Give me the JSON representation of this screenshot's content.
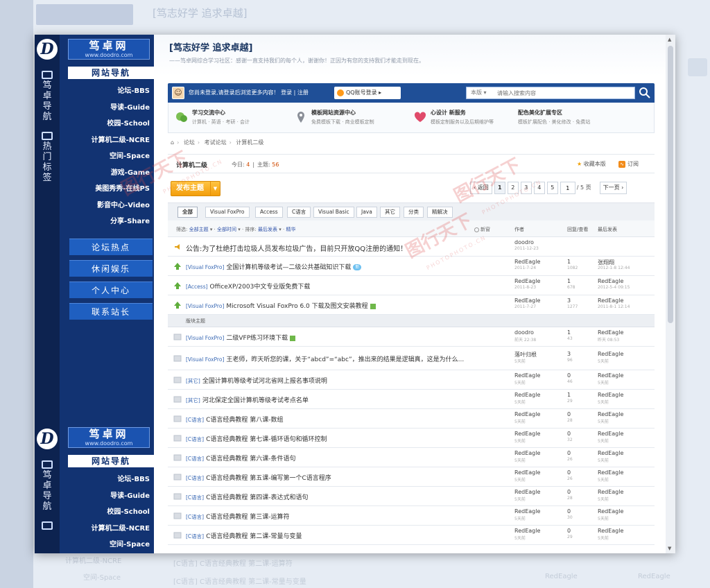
{
  "bg": {
    "title": "[笃志好学 追求卓越]",
    "nav_item_1": "计算机二级-NCRE",
    "nav_item_2": "空间-Space",
    "row_text_1": "[C语言] C语言经典教程 第二课-运算符",
    "row_text_2": "[C语言] C语言经典教程 第二课-常量与变量",
    "row_user": "RedEagle"
  },
  "rail": {
    "logo_letter": "D",
    "section1_label": "笃卓导航",
    "section2_label": "热门标签",
    "section3_label": "笃卓导航"
  },
  "nav": {
    "brand": "笃卓网",
    "brand_url": "www.doodro.com",
    "heading": "网站导航",
    "links": [
      "论坛-BBS",
      "导读-Guide",
      "校园-School",
      "计算机二级-NCRE",
      "空间-Space",
      "游戏-Game",
      "美图秀秀-在线PS",
      "影音中心-Video",
      "分享-Share"
    ],
    "buttons": [
      "论坛热点",
      "休闲娱乐",
      "个人中心",
      "联系站长"
    ],
    "links_partial": [
      "论坛-BBS",
      "导读-Guide",
      "校园-School",
      "计算机二级-NCRE",
      "空间-Space"
    ]
  },
  "page": {
    "title": "[笃志好学 追求卓越]",
    "subtitle": "——笃卓网综合学习社区：感谢一直支持我们的每个人，谢谢你！正因为有您的支持我们才能走到现在。"
  },
  "topbar": {
    "login_text": "您尚未登录,请登录后浏览更多内容！ 登录 | 注册",
    "qq_label": "QQ账号登录",
    "search_scope": "本版",
    "search_placeholder": "请输入搜索内容"
  },
  "services": [
    {
      "title": "学习交流中心",
      "desc": "计算机 · 英语 · 考研 · 会计"
    },
    {
      "title": "模板网站资源中心",
      "desc": "免费模板下载 · 商业模板定制"
    },
    {
      "title": "心设计 新服务",
      "desc": "模板定制服务以及后期维护等"
    },
    {
      "title": "配色美化扩展专区",
      "desc": "模板扩展配色 · 美化修改 · 免费站"
    }
  ],
  "breadcrumb": [
    "论坛",
    "考试论坛",
    "计算机二级"
  ],
  "forum": {
    "name": "计算机二级",
    "today_label": "今日:",
    "today": "4",
    "topics_label": "主题:",
    "topics": "56",
    "favorite": "收藏本版",
    "subscribe": "订阅"
  },
  "post_button": "发布主题",
  "pager": {
    "prev": "返回",
    "pages": [
      "1",
      "2",
      "3",
      "4",
      "5"
    ],
    "current": "1",
    "input": "1",
    "total": "/ 5 页",
    "next": "下一页"
  },
  "filters": [
    "全部",
    "Visual FoxPro",
    "Access",
    "C语言",
    "Visual Basic",
    "Java",
    "其它",
    "分类",
    "精解决"
  ],
  "sortbar": {
    "filter": "筛选:",
    "all_topics": "全部主题",
    "all_time": "全部时间",
    "sort": "排序:",
    "last_post": "最后发表",
    "digest": "精华",
    "new_window": "新窗",
    "col_author": "作者",
    "col_replies": "回复/查看",
    "col_last": "最后发表"
  },
  "section_label": "版块主题",
  "announcement": {
    "text": "公告:为了杜绝打击垃圾人员发布垃圾广告，目前只开放QQ注册的通知！",
    "author": "doodro",
    "date": "2011-12-23"
  },
  "sticky": [
    {
      "tag": "[Visual FoxPro]",
      "title": "全国计算机等级考试—二级公共基础知识下载",
      "author": "RedEagle",
      "date": "2011-7-24",
      "replies": "1",
      "views": "1082",
      "last_user": "张翔翔",
      "last_date": "2012-1-8 12:44"
    },
    {
      "tag": "[Access]",
      "title": "OfficeXP/2003中文专业版免费下载",
      "author": "RedEagle",
      "date": "2011-8-23",
      "replies": "1",
      "views": "678",
      "last_user": "RedEagle",
      "last_date": "2012-5-4 09:15"
    },
    {
      "tag": "[Visual FoxPro]",
      "title": "Microsoft Visual FoxPro 6.0 下载及图文安装教程",
      "author": "RedEagle",
      "date": "2011-7-27",
      "replies": "3",
      "views": "1277",
      "last_user": "RedEagle",
      "last_date": "2011-8-1 12:14"
    }
  ],
  "threads": [
    {
      "tag": "[Visual FoxPro]",
      "title": "二级VFP练习环境下载",
      "author": "doodro",
      "date": "前天 22:38",
      "replies": "1",
      "views": "43",
      "last_user": "RedEagle",
      "last_date": "昨天 08:53"
    },
    {
      "tag": "[Visual FoxPro]",
      "title": "王老师，昨天听您的课，关于“abcd”=“abc”，推出来的结果是逻辑真，这是为什么...",
      "author": "落叶归根",
      "date": "5天前",
      "replies": "3",
      "views": "96",
      "last_user": "RedEagle",
      "last_date": "5天前"
    },
    {
      "tag": "[其它]",
      "title": "全国计算机等级考试河北省网上报名事项说明",
      "author": "RedEagle",
      "date": "5天前",
      "replies": "0",
      "views": "46",
      "last_user": "RedEagle",
      "last_date": "5天前"
    },
    {
      "tag": "[其它]",
      "title": "河北保定全国计算机等级考试考点名单",
      "author": "RedEagle",
      "date": "5天前",
      "replies": "1",
      "views": "29",
      "last_user": "RedEagle",
      "last_date": "5天前"
    },
    {
      "tag": "[C语言]",
      "title": "C语言经典教程 第八课-数组",
      "author": "RedEagle",
      "date": "5天前",
      "replies": "0",
      "views": "28",
      "last_user": "RedEagle",
      "last_date": "5天前"
    },
    {
      "tag": "[C语言]",
      "title": "C语言经典教程 第七课-循环语句和循环控制",
      "author": "RedEagle",
      "date": "5天前",
      "replies": "0",
      "views": "32",
      "last_user": "RedEagle",
      "last_date": "5天前"
    },
    {
      "tag": "[C语言]",
      "title": "C语言经典教程 第六课-条件语句",
      "author": "RedEagle",
      "date": "5天前",
      "replies": "0",
      "views": "26",
      "last_user": "RedEagle",
      "last_date": "5天前"
    },
    {
      "tag": "[C语言]",
      "title": "C语言经典教程 第五课-编写第一个C语言程序",
      "author": "RedEagle",
      "date": "5天前",
      "replies": "0",
      "views": "26",
      "last_user": "RedEagle",
      "last_date": "5天前"
    },
    {
      "tag": "[C语言]",
      "title": "C语言经典教程 第四课-表达式和语句",
      "author": "RedEagle",
      "date": "5天前",
      "replies": "0",
      "views": "28",
      "last_user": "RedEagle",
      "last_date": "5天前"
    },
    {
      "tag": "[C语言]",
      "title": "C语言经典教程 第三课-运算符",
      "author": "RedEagle",
      "date": "5天前",
      "replies": "0",
      "views": "30",
      "last_user": "RedEagle",
      "last_date": "5天前"
    },
    {
      "tag": "[C语言]",
      "title": "C语言经典教程 第二课-常量与变量",
      "author": "RedEagle",
      "date": "5天前",
      "replies": "0",
      "views": "29",
      "last_user": "RedEagle",
      "last_date": "5天前"
    }
  ],
  "watermark": {
    "cn": "图行天下",
    "en": "PHOTOPHOTO.CN"
  },
  "colors": {
    "rail": "#0d2350",
    "nav": "#123372",
    "topbar": "#1f4f97",
    "accent": "#f39e0c"
  }
}
